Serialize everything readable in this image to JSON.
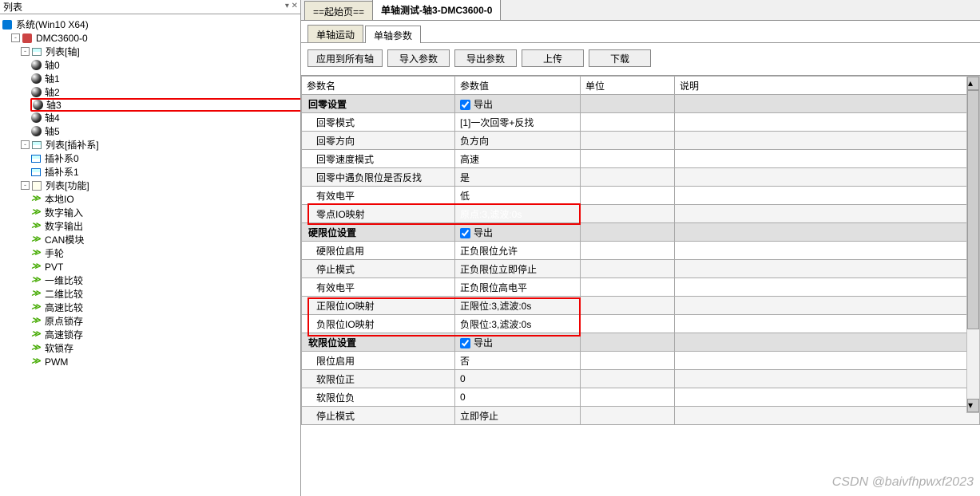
{
  "leftPanel": {
    "title": "列表",
    "sys": "系统(Win10 X64)",
    "device": "DMC3600-0",
    "axisList": "列表[轴]",
    "axes": [
      "轴0",
      "轴1",
      "轴2",
      "轴3",
      "轴4",
      "轴5"
    ],
    "interpList": "列表[插补系]",
    "interps": [
      "插补系0",
      "插补系1"
    ],
    "funcList": "列表[功能]",
    "funcs": [
      "本地IO",
      "数字输入",
      "数字输出",
      "CAN模块",
      "手轮",
      "PVT",
      "一维比较",
      "二维比较",
      "高速比较",
      "原点锁存",
      "高速锁存",
      "软锁存",
      "PWM"
    ]
  },
  "topTabs": {
    "start": "==起始页==",
    "main": "单轴测试-轴3-DMC3600-0"
  },
  "subTabs": {
    "move": "单轴运动",
    "param": "单轴参数"
  },
  "toolbar": {
    "applyAll": "应用到所有轴",
    "import": "导入参数",
    "export": "导出参数",
    "upload": "上传",
    "download": "下载"
  },
  "headers": {
    "name": "参数名",
    "val": "参数值",
    "unit": "单位",
    "desc": "说明"
  },
  "chkLabel": "导出",
  "sections": {
    "zero": "回零设置",
    "hard": "硬限位设置",
    "soft": "软限位设置"
  },
  "rows": {
    "zeroMode": {
      "n": "回零模式",
      "v": "[1]一次回零+反找"
    },
    "zeroDir": {
      "n": "回零方向",
      "v": "负方向"
    },
    "zeroSpeed": {
      "n": "回零速度模式",
      "v": "高速"
    },
    "zeroLimit": {
      "n": "回零中遇负限位是否反找",
      "v": "是"
    },
    "zeroLevel": {
      "n": "有效电平",
      "v": "低"
    },
    "zeroIO": {
      "n": "零点IO映射",
      "v": "原点:3,滤波:0s"
    },
    "hardEnable": {
      "n": "硬限位启用",
      "v": "正负限位允许"
    },
    "stopMode": {
      "n": "停止模式",
      "v": "正负限位立即停止"
    },
    "hardLevel": {
      "n": "有效电平",
      "v": "正负限位高电平"
    },
    "posLimIO": {
      "n": "正限位IO映射",
      "v": "正限位:3,滤波:0s"
    },
    "negLimIO": {
      "n": "负限位IO映射",
      "v": "负限位:3,滤波:0s"
    },
    "limEnable": {
      "n": "限位启用",
      "v": "否"
    },
    "softPos": {
      "n": "软限位正",
      "v": "0"
    },
    "softNeg": {
      "n": "软限位负",
      "v": "0"
    },
    "stopMode2": {
      "n": "停止模式",
      "v": "立即停止"
    }
  },
  "watermark": "CSDN @baivfhpwxf2023"
}
